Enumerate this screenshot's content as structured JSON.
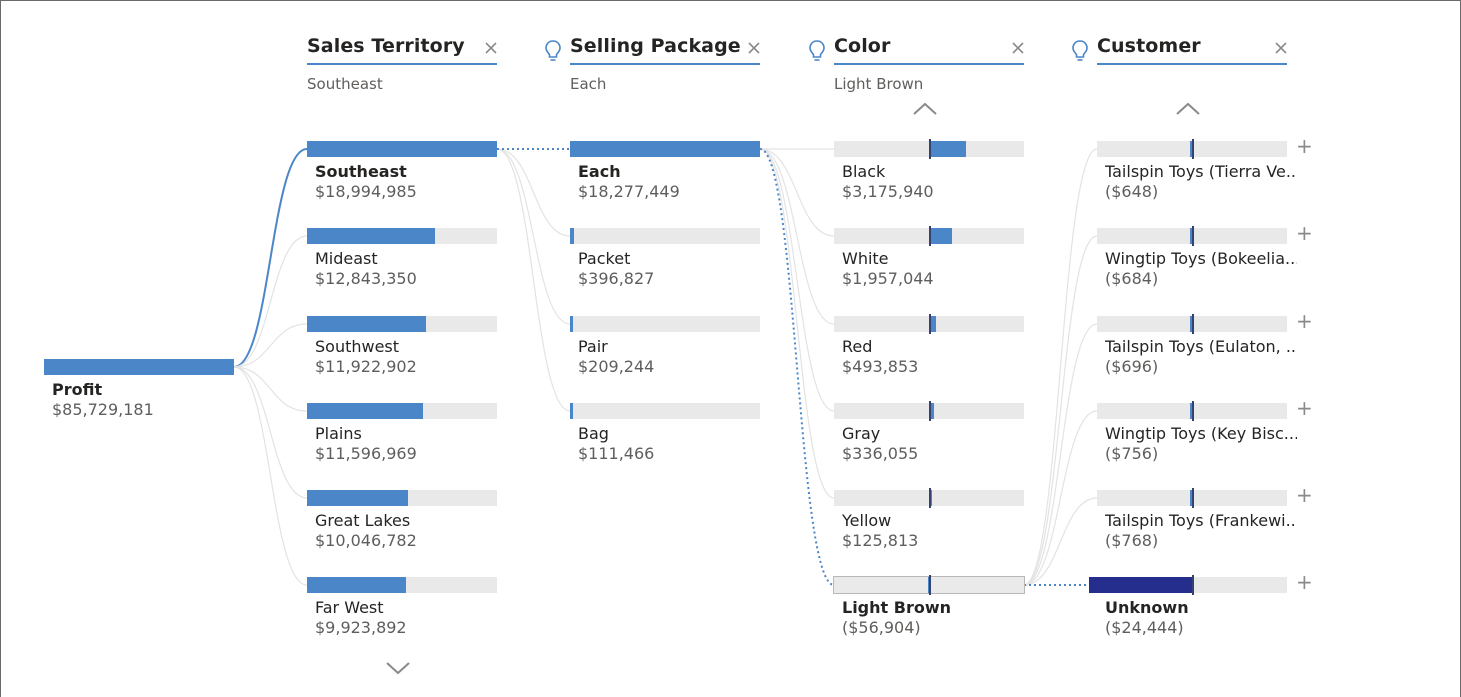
{
  "root": {
    "label": "Profit",
    "value": "$85,729,181"
  },
  "columns": [
    {
      "title": "Sales Territory",
      "selected": "Southeast",
      "has_bulb": false,
      "nodes": [
        {
          "label": "Southeast",
          "value": "$18,994,985",
          "share": 1.0,
          "selected": true
        },
        {
          "label": "Mideast",
          "value": "$12,843,350",
          "share": 0.676
        },
        {
          "label": "Southwest",
          "value": "$11,922,902",
          "share": 0.628
        },
        {
          "label": "Plains",
          "value": "$11,596,969",
          "share": 0.611
        },
        {
          "label": "Great Lakes",
          "value": "$10,046,782",
          "share": 0.529
        },
        {
          "label": "Far West",
          "value": "$9,923,892",
          "share": 0.522
        }
      ]
    },
    {
      "title": "Selling Package",
      "selected": "Each",
      "has_bulb": true,
      "nodes": [
        {
          "label": "Each",
          "value": "$18,277,449",
          "share": 1.0,
          "selected": true
        },
        {
          "label": "Packet",
          "value": "$396,827",
          "share": 0.022
        },
        {
          "label": "Pair",
          "value": "$209,244",
          "share": 0.011
        },
        {
          "label": "Bag",
          "value": "$111,466",
          "share": 0.006
        }
      ]
    },
    {
      "title": "Color",
      "selected": "Light Brown",
      "has_bulb": true,
      "nodes": [
        {
          "label": "Black",
          "value": "$3,175,940",
          "share": 0.19
        },
        {
          "label": "White",
          "value": "$1,957,044",
          "share": 0.116
        },
        {
          "label": "Red",
          "value": "$493,853",
          "share": 0.03
        },
        {
          "label": "Gray",
          "value": "$336,055",
          "share": 0.02
        },
        {
          "label": "Yellow",
          "value": "$125,813",
          "share": 0.008
        },
        {
          "label": "Light Brown",
          "value": "($56,904)",
          "share": -0.003,
          "selected": true
        }
      ]
    },
    {
      "title": "Customer",
      "selected": "",
      "has_bulb": true,
      "nodes": [
        {
          "label": "Tailspin Toys (Tierra Ve...",
          "value": "($648)",
          "share": -0.015
        },
        {
          "label": "Wingtip Toys (Bokeelia...",
          "value": "($684)",
          "share": -0.016
        },
        {
          "label": "Tailspin Toys (Eulaton, ...",
          "value": "($696)",
          "share": -0.016
        },
        {
          "label": "Wingtip Toys (Key Bisc...",
          "value": "($756)",
          "share": -0.017
        },
        {
          "label": "Tailspin Toys (Frankewi...",
          "value": "($768)",
          "share": -0.018
        },
        {
          "label": "Unknown",
          "value": "($24,444)",
          "share": -0.55,
          "selected": true
        }
      ]
    }
  ],
  "colors": {
    "bar": "#4a86c8",
    "bar_dark": "#252e8c",
    "track": "#e9e9e9",
    "link": "#4a86c8",
    "line_faint": "#e3e3e3"
  },
  "icons": {
    "close": "close-icon",
    "bulb": "lightbulb-icon",
    "expand": "plus-icon",
    "up": "chevron-up-icon",
    "down": "chevron-down-icon"
  }
}
